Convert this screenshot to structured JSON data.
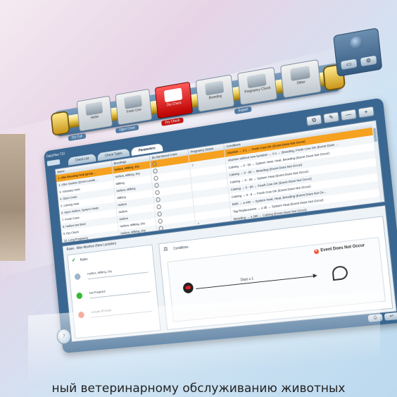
{
  "timeline": {
    "stages": [
      "Heifer",
      "Fresh Cow",
      "Dry Check",
      "Breeding",
      "Pregnancy Check",
      "Other"
    ],
    "labels": [
      "Dry Cull",
      "Open Cows",
      "Dry Check",
      "Export"
    ]
  },
  "window": {
    "title": "DairyPlan T10",
    "tabs": [
      "Check List",
      "Check Types",
      "Parameters"
    ],
    "toolbar": [
      "⧉",
      "✎",
      "—",
      "+"
    ]
  },
  "table": {
    "columns": [
      "Name",
      "Breedings",
      "Do Not Breed Cows",
      "Pregnancy Status",
      "Conditions"
    ],
    "rows": [
      {
        "name": "1. After Breeding Heat (group…",
        "breedings": "Heifers, Milking, Dry",
        "dnb": "",
        "preg": "",
        "cond": "Abortion → 0 1 → Fresh Cow OK (Event Does Not Occur)"
      },
      {
        "name": "2. After Abortion (Event Lactati…",
        "breedings": "Heifers, Milking, Dry",
        "dnb": "",
        "preg": "?",
        "cond": "Abortion without new lactation → 0 1 → Breeding, Fresh Cow OK (Event Does …"
      },
      {
        "name": "3. Voluntary Heat",
        "breedings": "Milking",
        "dnb": "",
        "preg": "",
        "cond": "Calving → 0 - 50 → System Heat, Heat, Breeding (Event Does Not Occur)"
      },
      {
        "name": "4. Open Cows",
        "breedings": "Heifers, Milking",
        "dnb": "",
        "preg": "",
        "cond": "Calving → 0 - 60 → Breeding (Event Does Not Occur)"
      },
      {
        "name": "5. Calving Heat",
        "breedings": "Milking",
        "dnb": "",
        "preg": "",
        "cond": "Calving → 0 - 50 → System Heat (Event Does Not Occur)"
      },
      {
        "name": "6. Open Heifers, System Heats",
        "breedings": "Heifers",
        "dnb": "",
        "preg": "",
        "cond": "Calving → 0 - 50 → Fresh Cow OK (Event Does Not Occur)"
      },
      {
        "name": "7. Fresh Cows",
        "breedings": "Heifers",
        "dnb": "",
        "preg": "",
        "cond": "Calving → 0 - 5 → Fresh Cow OK (Event Does Not Occur)"
      },
      {
        "name": "8. Heifers Not Bred",
        "breedings": "Heifers",
        "dnb": "",
        "preg": "",
        "cond": "Birth → ≥ 440 → System Heat, Heat, Breeding (Event Does Not Oc…"
      },
      {
        "name": "9. Dry Check",
        "breedings": "Heifers, Milking, Dry",
        "dnb": "",
        "preg": "",
        "cond": "Tag Replacement → ≥ 35 → System Heat (Event Does Not Occur)"
      },
      {
        "name": "10. Long Pregnancy",
        "breedings": "Heifers, Milking, Dry",
        "dnb": "",
        "preg": "+",
        "cond": "Breeding → ≥ 280 → Calving (Event Does Not Occur)"
      },
      {
        "name": "11. Dry Off (Days)",
        "breedings": "Milking",
        "dnb": "",
        "preg": "+",
        "cond": "Breeding → ≥ 205 → Dry-off, Positive Pregnancy Test (Event Does Not Occur)"
      }
    ]
  },
  "rule": {
    "title": "Rules · After Abortion (New Lactation)",
    "left_header": "Rules",
    "fields": [
      "Heifers, Milking, Dry",
      "Not Pregnant",
      "Include All Cows"
    ],
    "cond_header": "Conditions",
    "event_label": "Event Does Not Occur",
    "days_label": "Days ≥ 1"
  },
  "bottom": {
    "buttons": [
      "⎙",
      "↩"
    ],
    "side": "?"
  },
  "caption": "ный ветеринарному обслуживанию животных"
}
